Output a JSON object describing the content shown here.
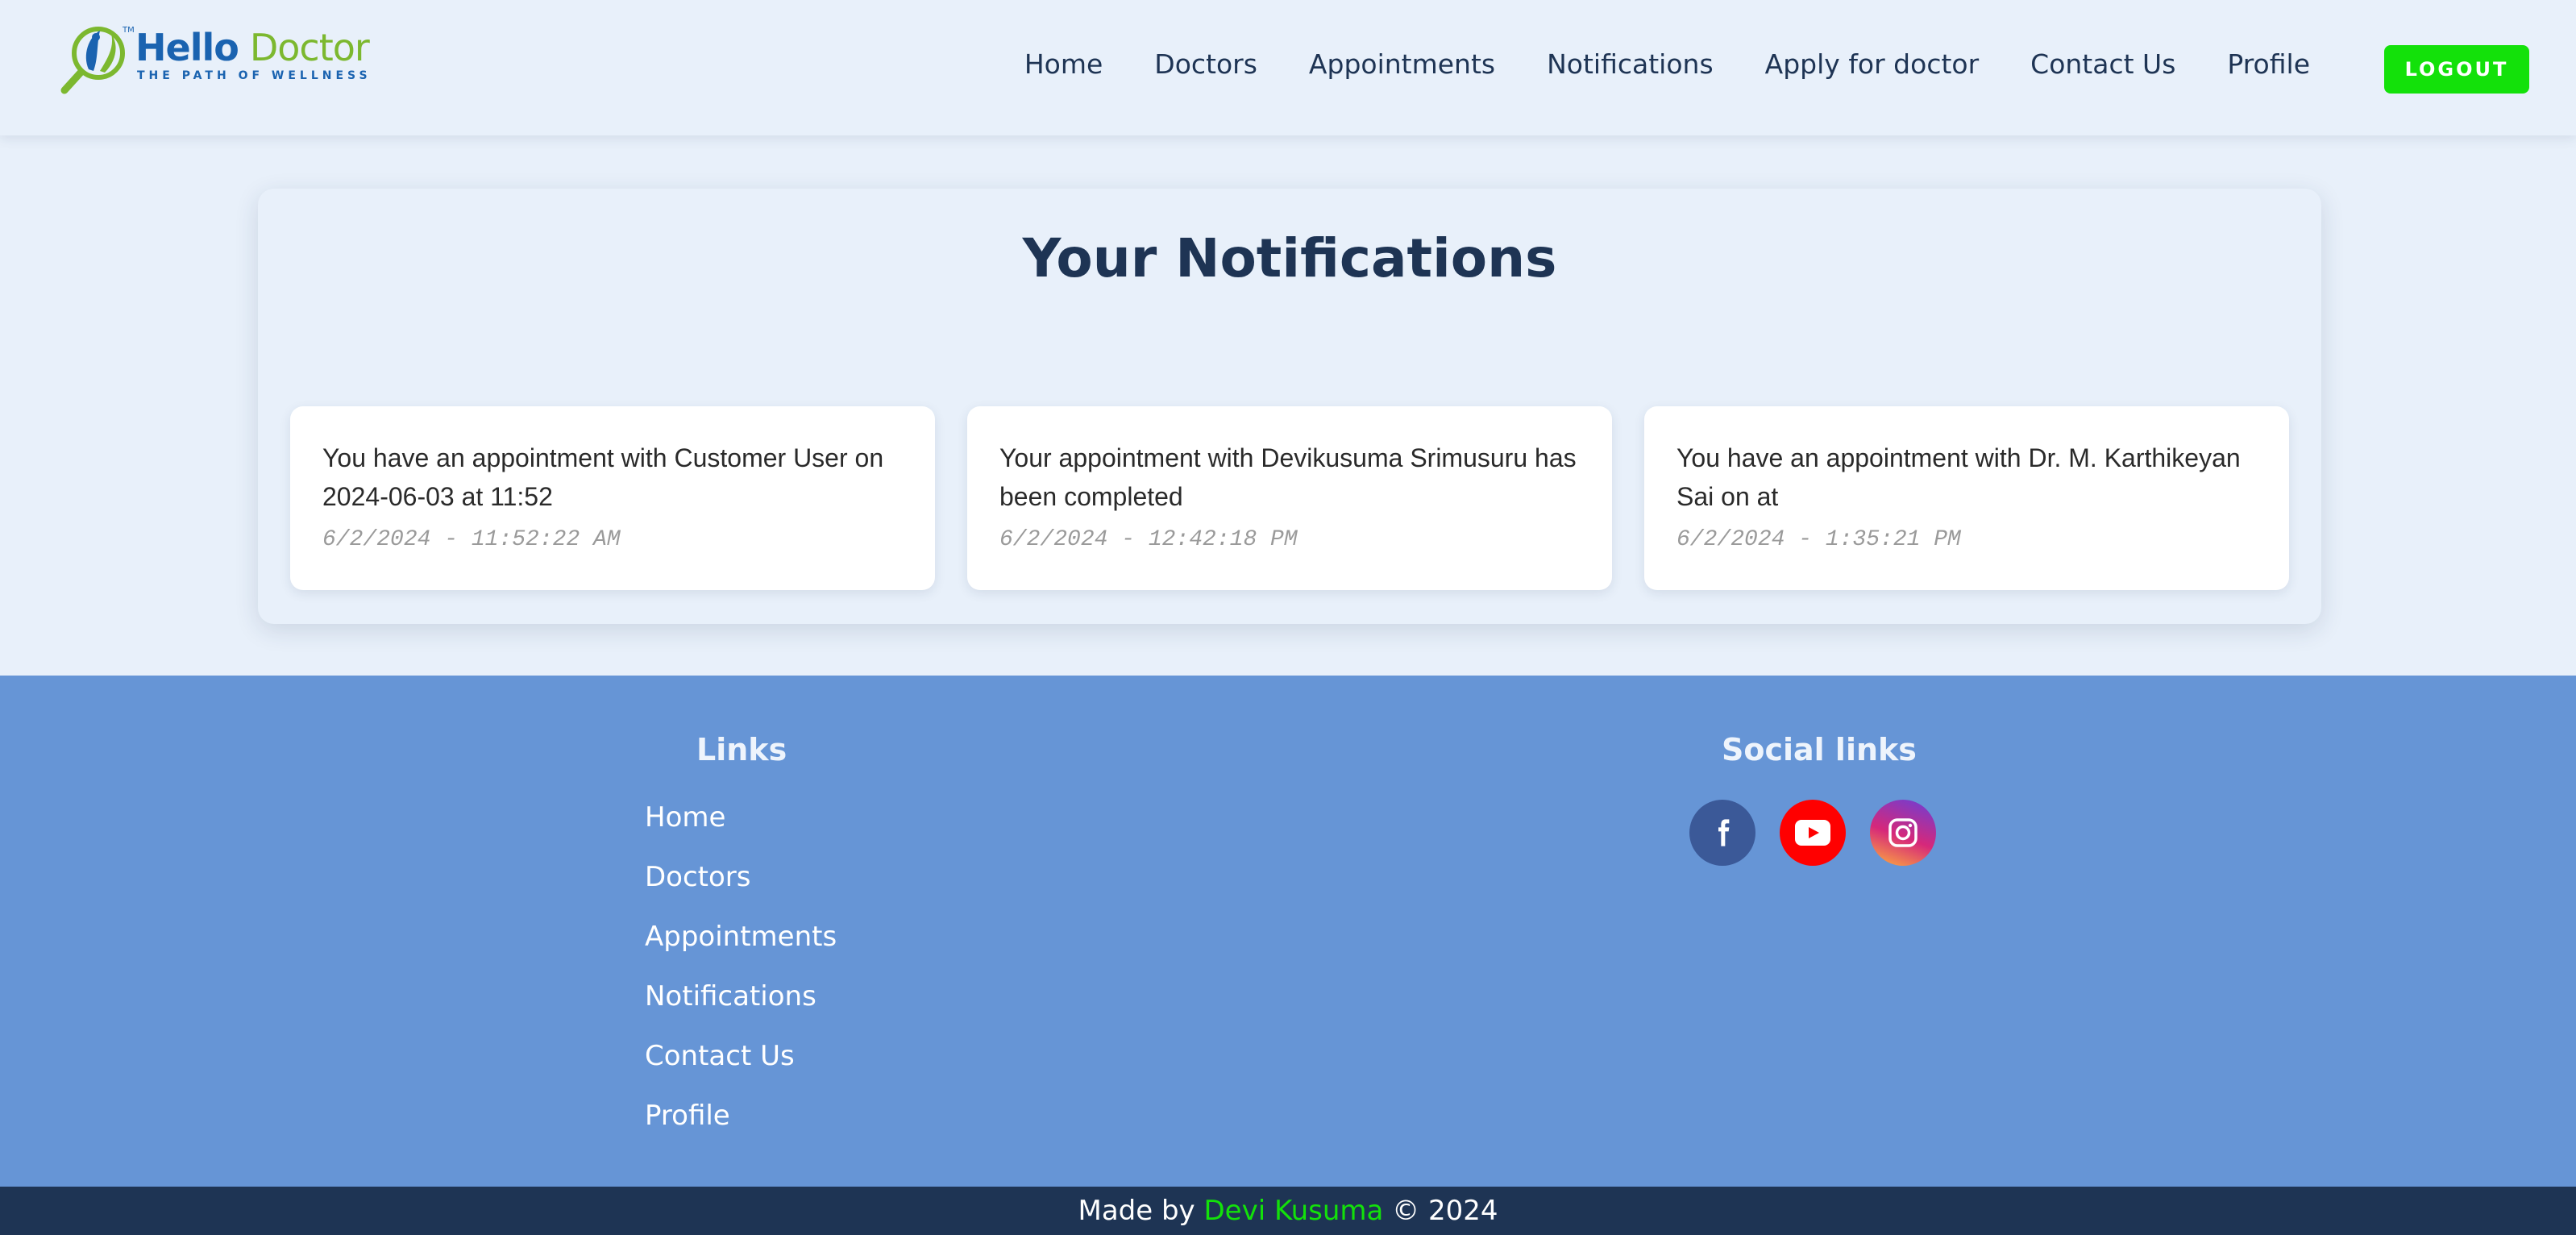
{
  "brand": {
    "name_part1": "Hello",
    "name_part2": "Doctor",
    "tagline": "THE PATH OF WELLNESS",
    "trademark": "TM",
    "colors": {
      "blue": "#1a63b0",
      "green": "#7cb82f"
    }
  },
  "nav": {
    "items": [
      {
        "label": "Home"
      },
      {
        "label": "Doctors"
      },
      {
        "label": "Appointments"
      },
      {
        "label": "Notifications"
      },
      {
        "label": "Apply for doctor"
      },
      {
        "label": "Contact Us"
      },
      {
        "label": "Profile"
      }
    ],
    "logout_label": "LOGOUT"
  },
  "main": {
    "title": "Your Notifications",
    "notifications": [
      {
        "message": "You have an appointment with Customer User on 2024-06-03 at 11:52",
        "time": "6/2/2024 - 11:52:22 AM"
      },
      {
        "message": "Your appointment with Devikusuma Srimusuru has been completed",
        "time": "6/2/2024 - 12:42:18 PM"
      },
      {
        "message": "You have an appointment with Dr. M. Karthikeyan Sai on at",
        "time": "6/2/2024 - 1:35:21 PM"
      }
    ]
  },
  "footer": {
    "links_title": "Links",
    "links": [
      {
        "label": "Home"
      },
      {
        "label": "Doctors"
      },
      {
        "label": "Appointments"
      },
      {
        "label": "Notifications"
      },
      {
        "label": "Contact Us"
      },
      {
        "label": "Profile"
      }
    ],
    "social_title": "Social links",
    "socials": [
      {
        "icon": "facebook-icon",
        "color": "#3b5998"
      },
      {
        "icon": "youtube-icon",
        "color": "#ff0000"
      },
      {
        "icon": "instagram-icon",
        "color": "#d6287a"
      }
    ],
    "credit_prefix": "Made by",
    "credit_author": "Devi Kusuma",
    "credit_suffix": "© 2024"
  },
  "colors": {
    "background": "#e8f0fa",
    "accent_green": "#13e10a",
    "footer_bg": "#6695d6",
    "bottom_bar": "#1e3454",
    "heading": "#1e3454"
  }
}
